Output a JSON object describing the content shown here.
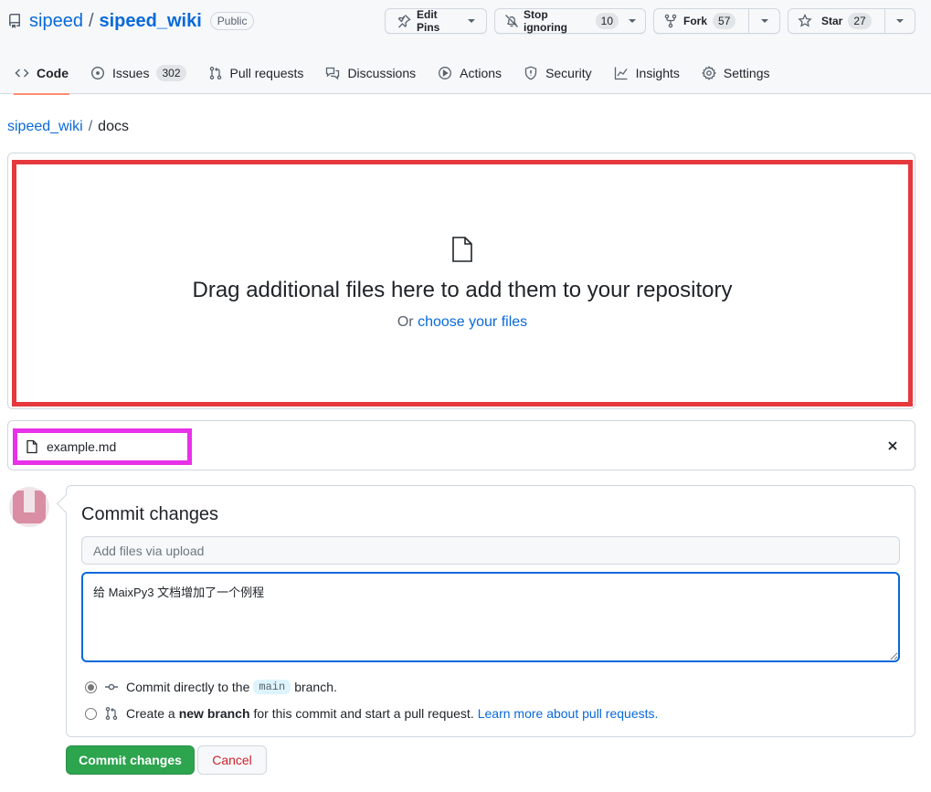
{
  "repo": {
    "owner": "sipeed",
    "separator": "/",
    "name": "sipeed_wiki",
    "visibility": "Public"
  },
  "header_buttons": {
    "edit_pins": "Edit Pins",
    "watch": "Stop ignoring",
    "watch_count": "10",
    "fork": "Fork",
    "fork_count": "57",
    "star": "Star",
    "star_count": "27"
  },
  "tabs": [
    {
      "label": "Code",
      "icon": "code-icon",
      "active": true
    },
    {
      "label": "Issues",
      "icon": "issue-icon",
      "count": "302"
    },
    {
      "label": "Pull requests",
      "icon": "pull-request-icon"
    },
    {
      "label": "Discussions",
      "icon": "discussions-icon"
    },
    {
      "label": "Actions",
      "icon": "play-icon"
    },
    {
      "label": "Security",
      "icon": "shield-icon"
    },
    {
      "label": "Insights",
      "icon": "graph-icon"
    },
    {
      "label": "Settings",
      "icon": "gear-icon"
    }
  ],
  "breadcrumb": {
    "repo": "sipeed_wiki",
    "separator": "/",
    "folder": "docs"
  },
  "dropzone": {
    "title": "Drag additional files here to add them to your repository",
    "or_text": "Or",
    "choose_link": "choose your files"
  },
  "files": {
    "name": "example.md"
  },
  "commit": {
    "title": "Commit changes",
    "summary_placeholder": "Add files via upload",
    "description": "给 MaixPy3 文档增加了一个例程",
    "option_direct_prefix": "Commit directly to the",
    "branch": "main",
    "option_direct_suffix": "branch.",
    "option_new_prefix": "Create a",
    "option_new_bold": "new branch",
    "option_new_suffix": "for this commit and start a pull request.",
    "learn_more": "Learn more about pull requests.",
    "submit_label": "Commit changes",
    "cancel_label": "Cancel"
  },
  "colors": {
    "link": "#0969da",
    "primary_button": "#2da44e",
    "danger": "#cf222e",
    "dropzone_highlight": "#e5393d",
    "file_highlight": "#e831e8",
    "active_tab_underline": "#fd8c73"
  }
}
